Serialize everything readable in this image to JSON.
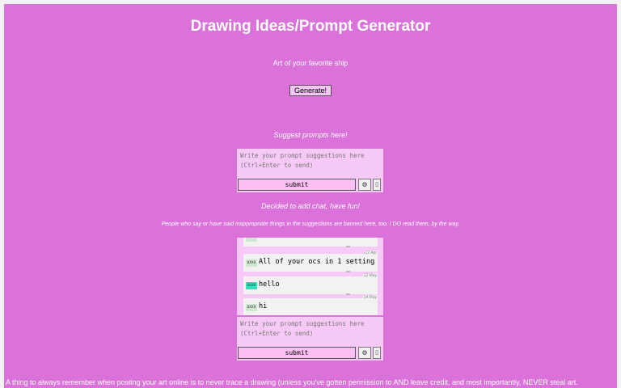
{
  "header": {
    "title": "Drawing Ideas/Prompt Generator"
  },
  "generator": {
    "prompt_text": "Art of your favorite ship",
    "generate_label": "Generate!"
  },
  "suggest": {
    "label": "Suggest prompts here!",
    "placeholder": "Write your prompt suggestions here (Ctrl+Enter to send)",
    "submit_label": "submit",
    "gear_icon": "gear-icon",
    "extra_icon": "box-icon"
  },
  "chat": {
    "label": "Decided to add chat, have fun!",
    "warning": "People who say or have said inappropriate things in the suggestions are banned here, too. I DO read them, by the way.",
    "messages": [
      {
        "badge": "",
        "text": "",
        "date": "",
        "badge_color": "#cfe8cf"
      },
      {
        "badge": "UXXX",
        "text": "All of your ocs in 1 setting",
        "date": "12 Apr",
        "badge_color": "#cfe8cf"
      },
      {
        "badge": "XXXX",
        "text": "hello",
        "date": "12 May",
        "badge_color": "#34e0c0"
      },
      {
        "badge": "UXXX",
        "text": "hi",
        "date": "14 May",
        "badge_color": "#cfe8cf"
      }
    ],
    "placeholder": "Write your prompt suggestions here (Ctrl+Enter to send)",
    "submit_label": "submit"
  },
  "footer": {
    "text": "A thing to always remember when posting your art online is to never trace a drawing (unless you've gotten permission to AND leave credit, and most importantly, NEVER steal art."
  }
}
